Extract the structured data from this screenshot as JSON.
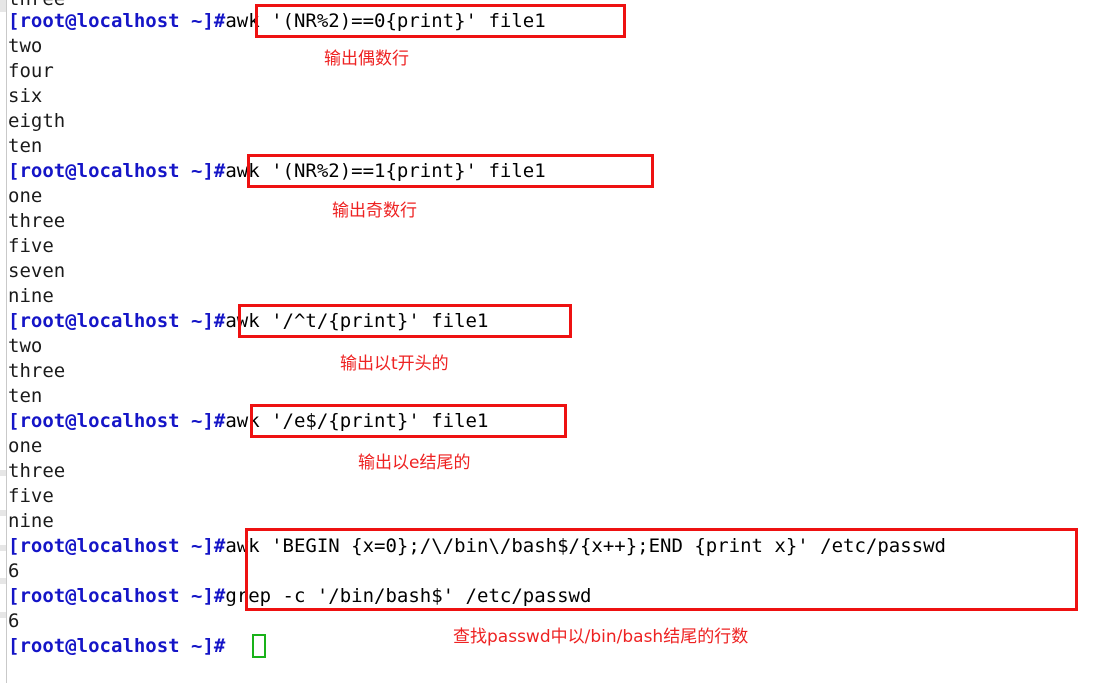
{
  "terminal": {
    "prompt": "[root@localhost ~]#",
    "colors": {
      "background": "#ffffff",
      "prompt_text": "#1515c7",
      "output_text": "#1a1a1a",
      "highlight_box": "#ee1111",
      "annotation_text": "#ee2222",
      "cursor": "#19b219"
    },
    "lines": [
      {
        "type": "output",
        "text": "three"
      },
      {
        "type": "command",
        "prompt": "[root@localhost ~]#",
        "text": "awk '(NR%2)==0{print}' file1"
      },
      {
        "type": "output",
        "text": "two"
      },
      {
        "type": "output",
        "text": "four"
      },
      {
        "type": "output",
        "text": "six"
      },
      {
        "type": "output",
        "text": "eigth"
      },
      {
        "type": "output",
        "text": "ten"
      },
      {
        "type": "command",
        "prompt": "[root@localhost ~]#",
        "text": "awk '(NR%2)==1{print}' file1"
      },
      {
        "type": "output",
        "text": "one"
      },
      {
        "type": "output",
        "text": "three"
      },
      {
        "type": "output",
        "text": "five"
      },
      {
        "type": "output",
        "text": "seven"
      },
      {
        "type": "output",
        "text": "nine"
      },
      {
        "type": "command",
        "prompt": "[root@localhost ~]#",
        "text": "awk '/^t/{print}' file1"
      },
      {
        "type": "output",
        "text": "two"
      },
      {
        "type": "output",
        "text": "three"
      },
      {
        "type": "output",
        "text": "ten"
      },
      {
        "type": "command",
        "prompt": "[root@localhost ~]#",
        "text": "awk '/e$/{print}' file1"
      },
      {
        "type": "output",
        "text": "one"
      },
      {
        "type": "output",
        "text": "three"
      },
      {
        "type": "output",
        "text": "five"
      },
      {
        "type": "output",
        "text": "nine"
      },
      {
        "type": "command",
        "prompt": "[root@localhost ~]#",
        "text": "awk 'BEGIN {x=0};/\\/bin\\/bash$/{x++};END {print x}' /etc/passwd"
      },
      {
        "type": "output",
        "text": "6"
      },
      {
        "type": "command",
        "prompt": "[root@localhost ~]#",
        "text": "grep -c '/bin/bash$' /etc/passwd"
      },
      {
        "type": "output",
        "text": "6"
      },
      {
        "type": "command",
        "prompt": "[root@localhost ~]#",
        "text": ""
      }
    ]
  },
  "annotations": [
    {
      "text": "输出偶数行"
    },
    {
      "text": "输出奇数行"
    },
    {
      "text": "输出以t开头的"
    },
    {
      "text": "输出以e结尾的"
    },
    {
      "text": "查找passwd中以/bin/bash结尾的行数"
    }
  ]
}
